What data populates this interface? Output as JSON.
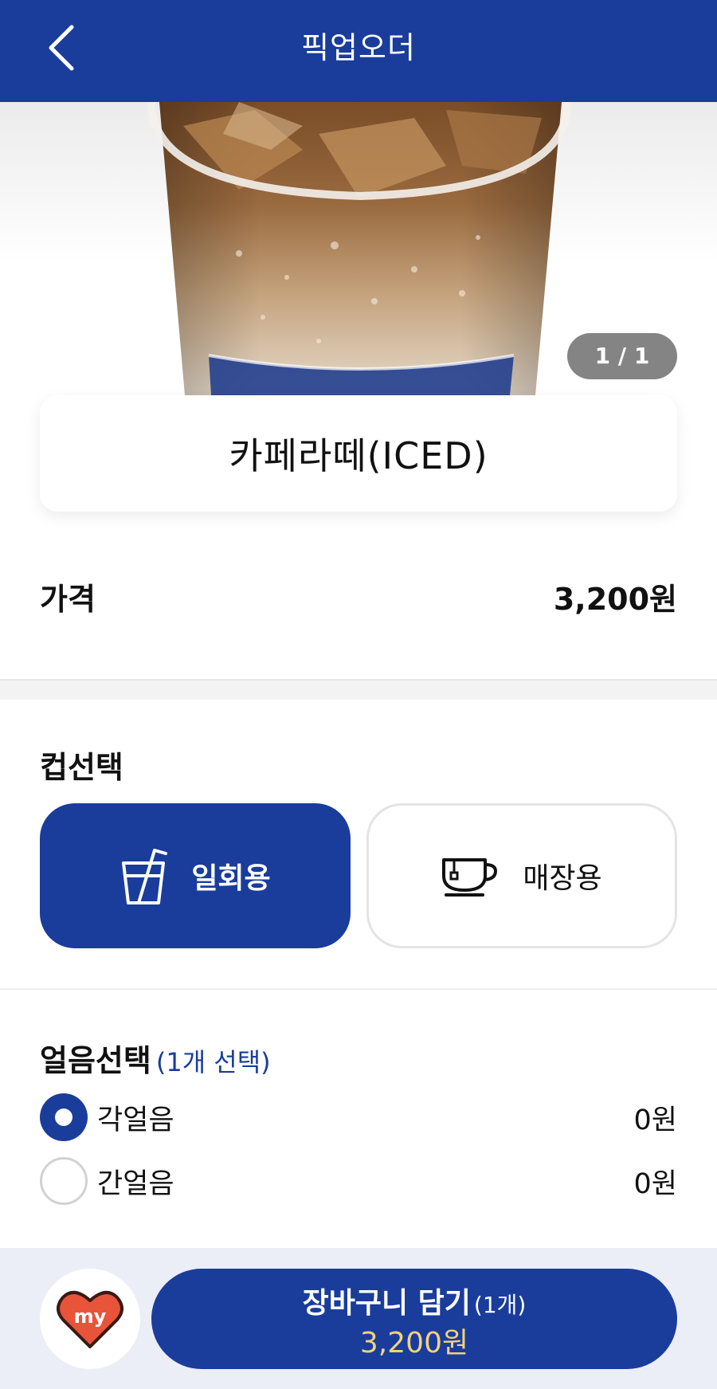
{
  "header": {
    "title": "픽업오더"
  },
  "hero": {
    "counter": "1 / 1"
  },
  "product": {
    "name": "카페라떼(ICED)"
  },
  "price": {
    "label": "가격",
    "value": "3,200원"
  },
  "cup": {
    "title": "컵선택",
    "options": [
      {
        "label": "일회용",
        "icon": "disposable-cup-icon",
        "selected": true
      },
      {
        "label": "매장용",
        "icon": "mug-icon",
        "selected": false
      }
    ]
  },
  "ice": {
    "title": "얼음선택",
    "subtitle": "(1개 선택)",
    "options": [
      {
        "label": "각얼음",
        "price": "0원",
        "selected": true
      },
      {
        "label": "간얼음",
        "price": "0원",
        "selected": false
      }
    ]
  },
  "bottom": {
    "my_icon": "my-heart-icon",
    "my_text": "my",
    "cart_label": "장바구니 담기",
    "cart_count": "(1개)",
    "cart_price": "3,200원"
  },
  "colors": {
    "primary": "#1a3d9c",
    "price_highlight": "#f3d27a",
    "heart": "#e8543a"
  }
}
